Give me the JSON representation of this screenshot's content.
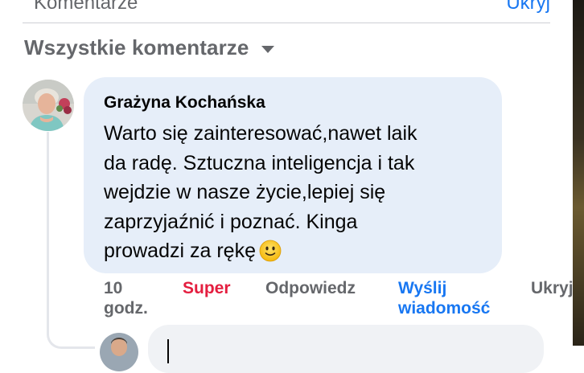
{
  "section": {
    "title": "Komentarze",
    "hide_label": "Ukryj"
  },
  "filter": {
    "label": "Wszystkie komentarze",
    "icon": "caret-down-icon"
  },
  "comment": {
    "author": "Grażyna Kochańska",
    "text_lines": [
      "Warto się zainteresować,nawet laik",
      "da radę. Sztuczna inteligencja i tak",
      "wejdzie w nasze życie,lepiej się",
      "zaprzyjaźnić i poznać. Kinga",
      "prowadzi za rękę"
    ],
    "emoji": "slightly-smiling-face",
    "time_lines": [
      "10",
      "godz."
    ],
    "reaction": "Super",
    "reply_label": "Odpowiedz",
    "send_lines": [
      "Wyślij",
      "wiadomość"
    ],
    "hide_label": "Ukryj"
  },
  "colors": {
    "accent": "#1877f2",
    "reaction_super": "#e41e3f",
    "muted_text": "#65676b",
    "bubble": "#e6eef9"
  }
}
